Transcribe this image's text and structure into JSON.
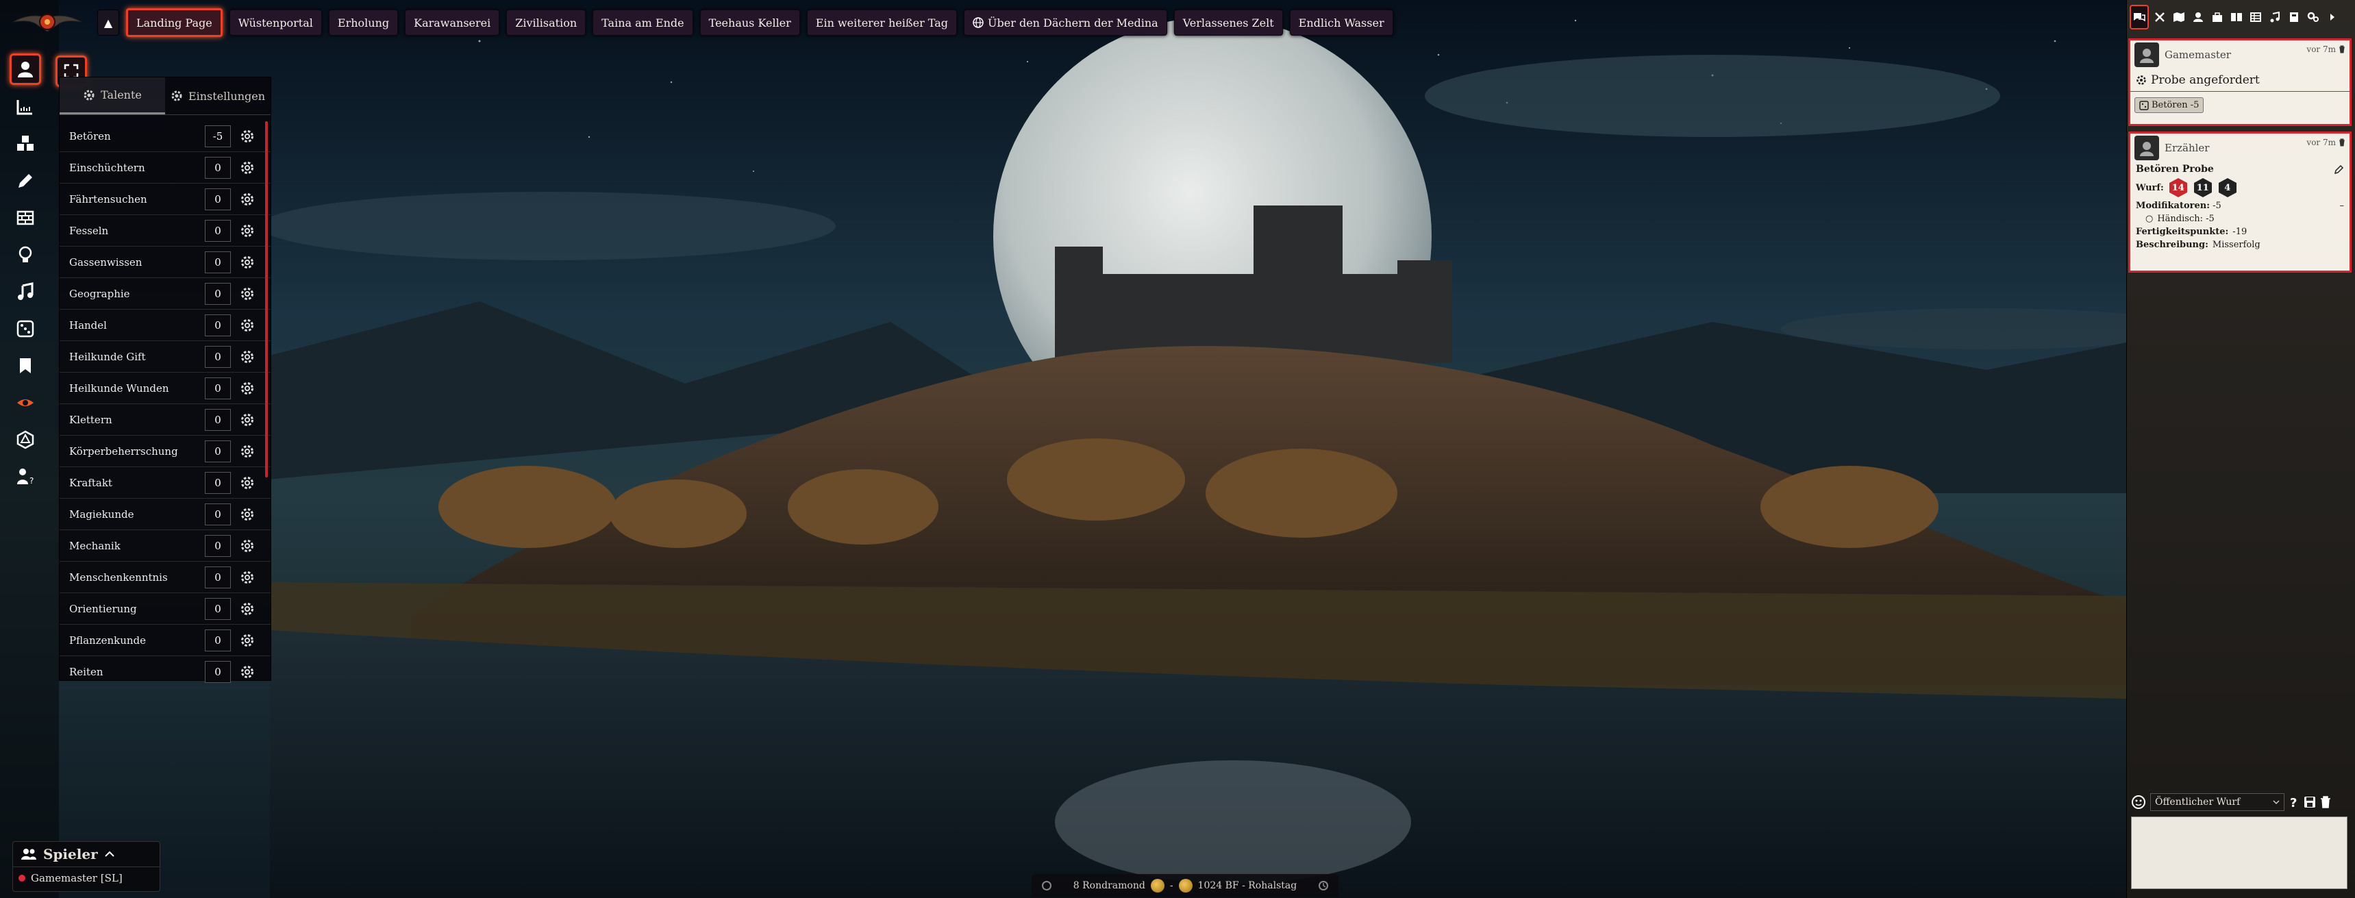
{
  "scene_nav": {
    "toggle": "▲",
    "scenes": [
      {
        "label": "Landing Page",
        "active": true
      },
      {
        "label": "Wüstenportal"
      },
      {
        "label": "Erholung"
      },
      {
        "label": "Karawanserei"
      },
      {
        "label": "Zivilisation"
      },
      {
        "label": "Taina am Ende"
      },
      {
        "label": "Teehaus Keller"
      },
      {
        "label": "Ein weiterer heißer Tag"
      },
      {
        "label": "Über den Dächern der Medina",
        "icon": "globe-icon"
      },
      {
        "label": "Verlassenes Zelt"
      },
      {
        "label": "Endlich Wasser"
      }
    ]
  },
  "skills_panel": {
    "tabs": [
      {
        "label": "Talente",
        "icon": "gear-icon",
        "active": true
      },
      {
        "label": "Einstellungen",
        "icon": "gear-icon"
      }
    ],
    "skills": [
      {
        "name": "Betören",
        "value": "-5"
      },
      {
        "name": "Einschüchtern",
        "value": "0"
      },
      {
        "name": "Fährtensuchen",
        "value": "0"
      },
      {
        "name": "Fesseln",
        "value": "0"
      },
      {
        "name": "Gassenwissen",
        "value": "0"
      },
      {
        "name": "Geographie",
        "value": "0"
      },
      {
        "name": "Handel",
        "value": "0"
      },
      {
        "name": "Heilkunde Gift",
        "value": "0"
      },
      {
        "name": "Heilkunde Wunden",
        "value": "0"
      },
      {
        "name": "Klettern",
        "value": "0"
      },
      {
        "name": "Körperbeherrschung",
        "value": "0"
      },
      {
        "name": "Kraftakt",
        "value": "0"
      },
      {
        "name": "Magiekunde",
        "value": "0"
      },
      {
        "name": "Mechanik",
        "value": "0"
      },
      {
        "name": "Menschenkenntnis",
        "value": "0"
      },
      {
        "name": "Orientierung",
        "value": "0"
      },
      {
        "name": "Pflanzenkunde",
        "value": "0"
      },
      {
        "name": "Reiten",
        "value": "0"
      }
    ]
  },
  "players": {
    "title": "Spieler",
    "list": [
      {
        "name": "Gamemaster [SL]",
        "color": "#e0293a"
      }
    ]
  },
  "calendar": {
    "date": "8 Rondramond",
    "separator": "-",
    "year": "1024 BF - Rohalstag"
  },
  "chat": {
    "messages": [
      {
        "sender": "Gamemaster",
        "time": "vor 7m",
        "title": "Probe angefordert",
        "chip": "Betören -5"
      },
      {
        "sender": "Erzähler",
        "time": "vor 7m",
        "roll_title": "Betören Probe",
        "wurf_label": "Wurf:",
        "dice": [
          "14",
          "11",
          "4"
        ],
        "mod_label": "Modifikatoren:",
        "mod_value": " -5",
        "mod_item": "Händisch: -5",
        "fp_label": "Fertigkeitspunkte:",
        "fp_value": " -19",
        "desc_label": "Beschreibung:",
        "desc_value": " Misserfolg"
      }
    ],
    "roll_mode": "Öffentlicher Wurf"
  },
  "colors": {
    "accent_red": "#e8432a",
    "border_red": "#d42432"
  }
}
